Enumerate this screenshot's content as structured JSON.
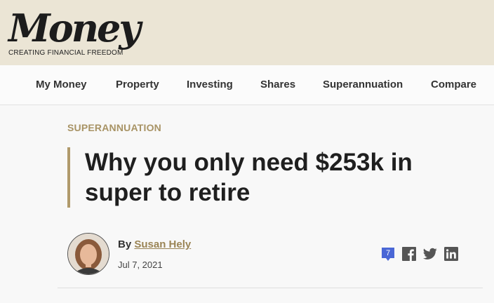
{
  "masthead": {
    "logo_text": "Money",
    "tagline": "CREATING FINANCIAL FREEDOM"
  },
  "nav": {
    "items": [
      {
        "label": "My Money"
      },
      {
        "label": "Property"
      },
      {
        "label": "Investing"
      },
      {
        "label": "Shares"
      },
      {
        "label": "Superannuation"
      },
      {
        "label": "Compare"
      }
    ]
  },
  "article": {
    "section": "SUPERANNUATION",
    "title": "Why you only need $253k in super to retire",
    "byline_prefix": "By",
    "author": "Susan Hely",
    "date": "Jul 7, 2021"
  },
  "share": {
    "comment_count": "7",
    "icons": [
      "comment-icon",
      "facebook-icon",
      "twitter-icon",
      "linkedin-icon"
    ],
    "comment_color": "#4a67d6",
    "icon_color": "#555555"
  },
  "colors": {
    "accent": "#a89365",
    "masthead_bg": "#ebe5d5"
  }
}
